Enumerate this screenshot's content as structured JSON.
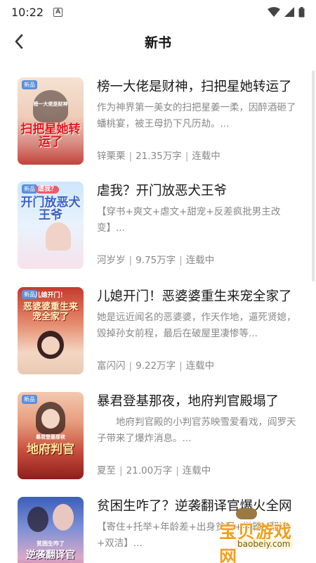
{
  "status_bar": {
    "time": "10:22",
    "notification_letter": "A"
  },
  "header": {
    "title": "新书"
  },
  "books": [
    {
      "title": "榜一大佬是财神，扫把星她转运了",
      "desc": "作为神界第一美女的扫把星姜一柔，因醉酒砸了蟠桃宴，被王母扔下凡历劫。...",
      "author": "锌栗栗",
      "words": "21.35万字",
      "status": "连载中",
      "cover_top": "榜一大佬是财神",
      "cover_main": "扫把星她转运了",
      "cover_badge": "新品"
    },
    {
      "title": "虐我？开门放恶犬王爷",
      "desc": "【穿书+爽文+虐文+甜宠+反差疯批男主改变】...",
      "author": "河岁岁",
      "words": "9.75万字",
      "status": "连载中",
      "cover_top": "虐我？",
      "cover_main": "开门放恶犬王爷",
      "cover_badge": "新品"
    },
    {
      "title": "儿媳开门！恶婆婆重生来宠全家了",
      "desc": "她是远近闻名的恶婆婆，作天作地，逼死贤媳，毁掉孙女前程，最后在破屋里凄惨等...",
      "author": "富闪闪",
      "words": "9.22万字",
      "status": "连载中",
      "cover_top": "儿媳开门！",
      "cover_main": "恶婆婆重生来宠全家了",
      "cover_badge": "新品"
    },
    {
      "title": "暴君登基那夜，地府判官殿塌了",
      "desc": "　　地府判官殿的小判官苏映雪爱看戏，阎罗天子带来了爆炸消息。...",
      "author": "夏至",
      "words": "21.00万字",
      "status": "连载中",
      "cover_top": "暴君登基那夜",
      "cover_main": "地府判官",
      "cover_badge": "新品"
    },
    {
      "title": "贫困生咋了？逆袭翻译官爆火全网",
      "desc": "【寄住+托举+年龄差+出身贫困+学霸+翻译+双洁】...",
      "author": "",
      "words": "",
      "status": "",
      "cover_top": "贫困生咋了",
      "cover_main": "逆袭翻译官",
      "cover_badge": ""
    }
  ],
  "watermark": {
    "main": "宝贝游戏网",
    "url": "baobeiy.com"
  }
}
